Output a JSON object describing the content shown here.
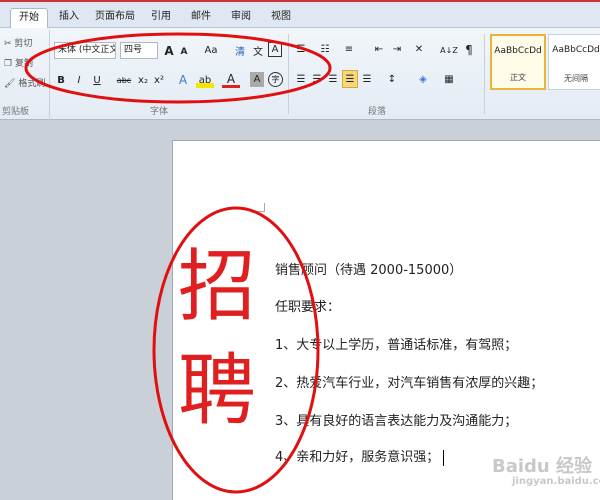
{
  "tabs": [
    "开始",
    "插入",
    "页面布局",
    "引用",
    "邮件",
    "审阅",
    "视图"
  ],
  "clipboard": {
    "cut": "剪切",
    "copy": "复制",
    "painter": "格式刷",
    "group": "剪贴板"
  },
  "font": {
    "name": "宋体 (中文正文)",
    "size": "四号",
    "grow": "A",
    "shrink": "A",
    "case": "Aa",
    "clear": "清",
    "phonetic": "文",
    "border_char": "A",
    "bold": "B",
    "italic": "I",
    "underline": "U",
    "strike": "abc",
    "sub": "x₂",
    "sup": "x²",
    "effect": "A",
    "highlight": "ab",
    "color": "A",
    "shade": "A",
    "enclose": "字",
    "group": "字体"
  },
  "paragraph": {
    "group": "段落",
    "sort": "A↓Z",
    "marks": "¶"
  },
  "styles": [
    {
      "sample": "AaBbCcDd",
      "name": "正文"
    },
    {
      "sample": "AaBbCcDd",
      "name": "无间隔"
    }
  ],
  "document": {
    "big_chars": [
      "招",
      "聘"
    ],
    "lines": [
      "销售顾问（待遇 2000-15000）",
      "任职要求：",
      "1、大专以上学历，普通话标准，有驾照；",
      "2、热爱汽车行业，对汽车销售有浓厚的兴趣；",
      "3、具有良好的语言表达能力及沟通能力；",
      "4、亲和力好，服务意识强；"
    ]
  },
  "watermark": {
    "main": "Baidu 经验",
    "sub": "jingyan.baidu.com"
  },
  "colors": {
    "accent": "#e02020",
    "highlight": "#f5e600",
    "selected_style": "#e9b43a"
  }
}
